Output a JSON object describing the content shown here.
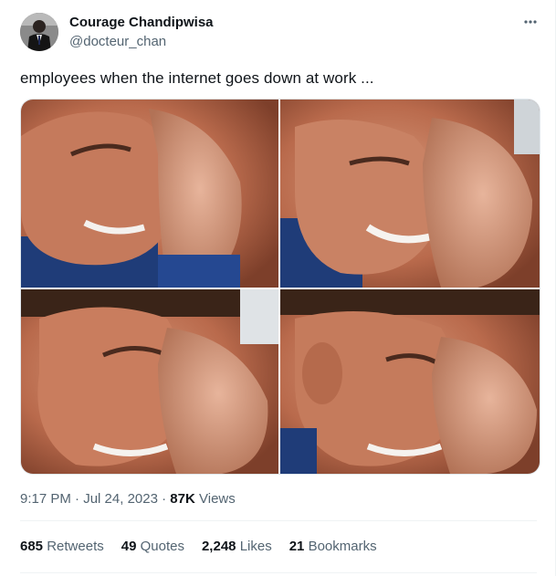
{
  "author": {
    "name": "Courage Chandipwisa",
    "handle": "@docteur_chan"
  },
  "tweet": {
    "text": "employees when the internet goes down at work ...",
    "time": "9:17 PM",
    "date": "Jul 24, 2023",
    "views_count": "87K",
    "views_label": "Views"
  },
  "stats": [
    {
      "count": "685",
      "label": "Retweets"
    },
    {
      "count": "49",
      "label": "Quotes"
    },
    {
      "count": "2,248",
      "label": "Likes"
    },
    {
      "count": "21",
      "label": "Bookmarks"
    }
  ],
  "icons": {
    "more": "more-horizontal-icon"
  },
  "colors": {
    "text_primary": "#0f1419",
    "text_secondary": "#536471",
    "divider": "#eff3f4"
  }
}
